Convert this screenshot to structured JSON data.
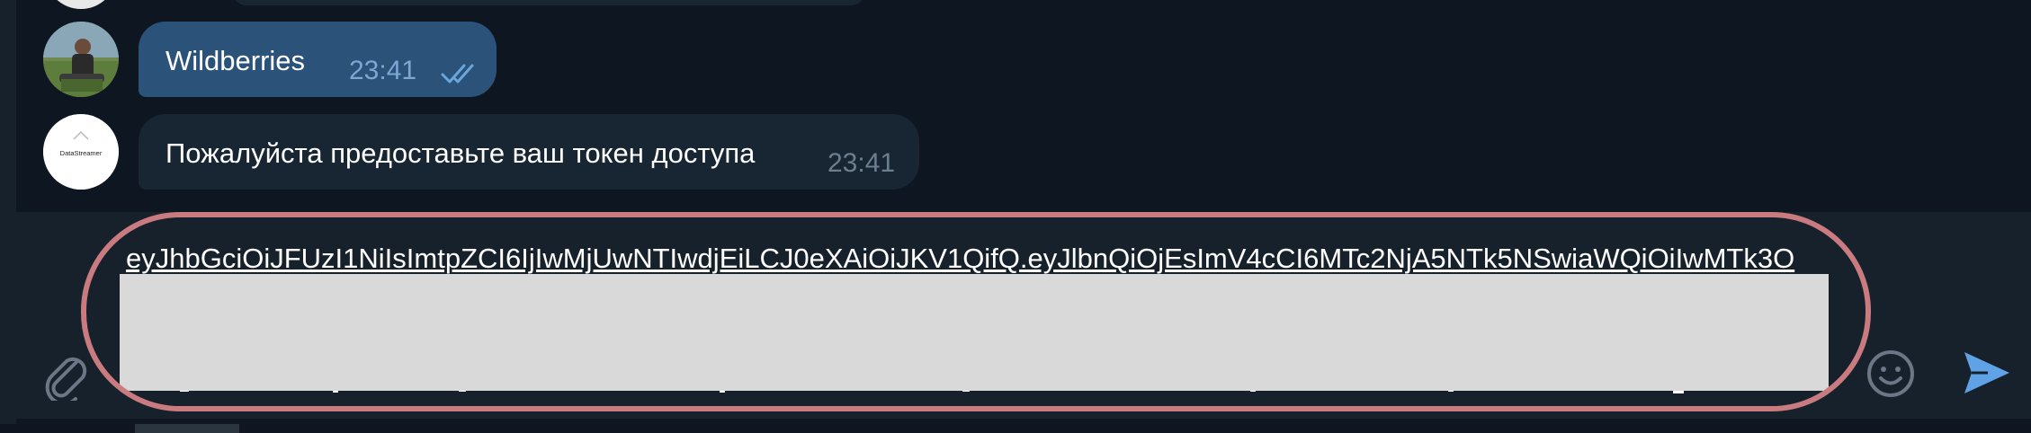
{
  "messages": [
    {
      "direction": "outgoing",
      "text": "Wildberries",
      "time": "23:41",
      "status_icon": "double-check-icon"
    },
    {
      "direction": "incoming",
      "text": "Пожалуйста предоставьте ваш токен доступа",
      "time": "23:41",
      "avatar_label": "DataStreamer"
    }
  ],
  "composer": {
    "value": "eyJhbGciOiJFUzI1NiIsImtpZCI6IjIwMjUwNTIwdjEiLCJ0eXAiOiJKV1QifQ.eyJlbnQiOjEsImV4cCI6MTc2NjA5NTk5NSwiaWQiOiIwMTk3O",
    "redacted": true,
    "attach_icon": "paperclip-icon",
    "emoji_icon": "smile-icon",
    "send_icon": "send-arrow-icon"
  },
  "colors": {
    "chat_background": "#0e1621",
    "outgoing_bubble": "#2b5278",
    "incoming_bubble": "#182533",
    "composer_background": "#17212b",
    "highlight_ring": "#c97b7f",
    "redaction": "#d9d9d9",
    "send_icon": "#5fa3e6"
  }
}
